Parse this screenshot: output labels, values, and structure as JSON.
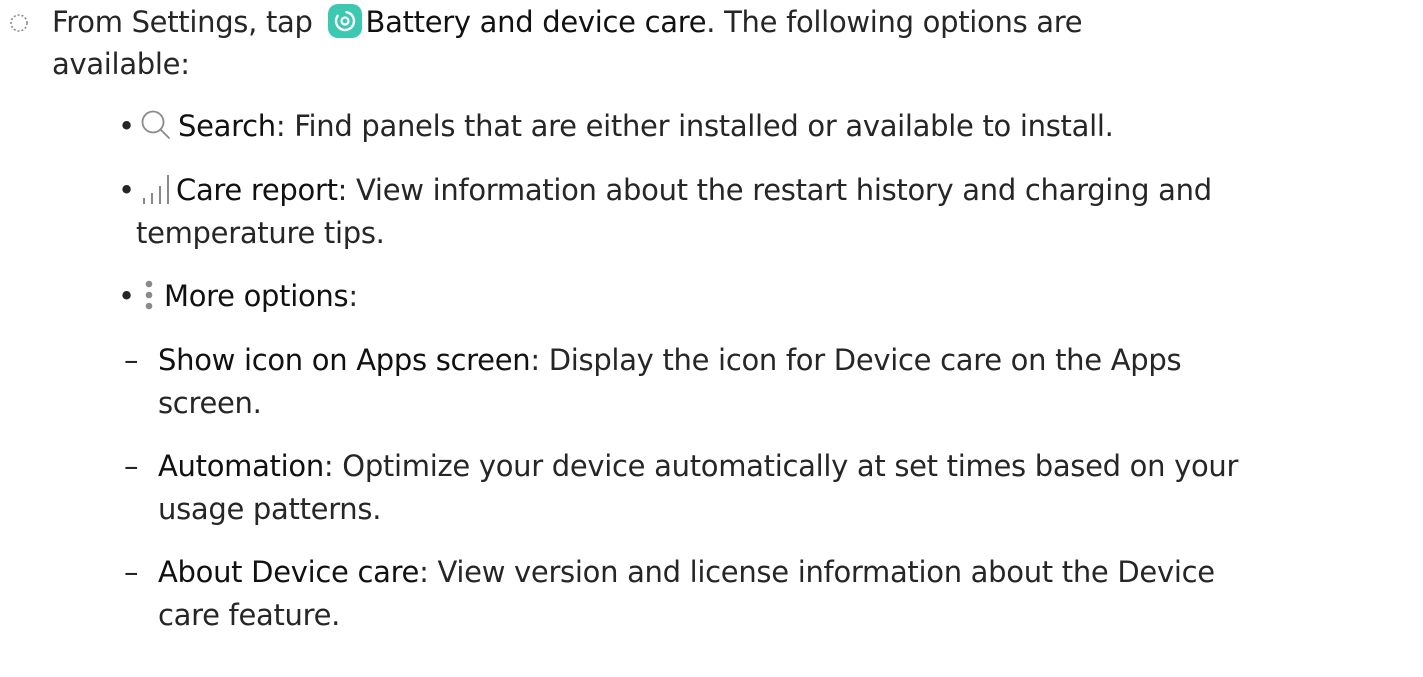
{
  "intro": {
    "line1_prefix": "From Settings, tap ",
    "app_name": "Battery and device care",
    "line1_suffix": ". The following options are",
    "line2": "available:"
  },
  "options": {
    "search": {
      "label": "Search",
      "desc": ": Find panels that are either installed or available to install."
    },
    "care_report": {
      "label": "Care report",
      "desc_line1": ": View information about the restart history and charging and",
      "desc_line2": "temperature tips."
    },
    "more_options": {
      "label": "More options",
      "suffix": ":"
    }
  },
  "sub_options": {
    "show_icon": {
      "label": "Show icon on Apps screen",
      "desc_line1": ": Display the icon for Device care on the Apps",
      "desc_line2": "screen."
    },
    "automation": {
      "label": "Automation",
      "desc_line1": ": Optimize your device automatically at set times based on your",
      "desc_line2": "usage patterns."
    },
    "about": {
      "label": "About Device care",
      "desc_line1": ": View version and license information about the Device",
      "desc_line2": "care feature."
    }
  },
  "glyphs": {
    "bullet": "•",
    "dash": "–"
  },
  "icons": {
    "step": "step-circle-icon",
    "battery": "battery-device-care-icon",
    "search": "search-icon",
    "report": "bar-chart-icon",
    "more": "more-options-icon"
  },
  "colors": {
    "battery_icon_bg": "#3cc8b1",
    "text": "#262626",
    "icon_gray": "#8a8a8a"
  }
}
